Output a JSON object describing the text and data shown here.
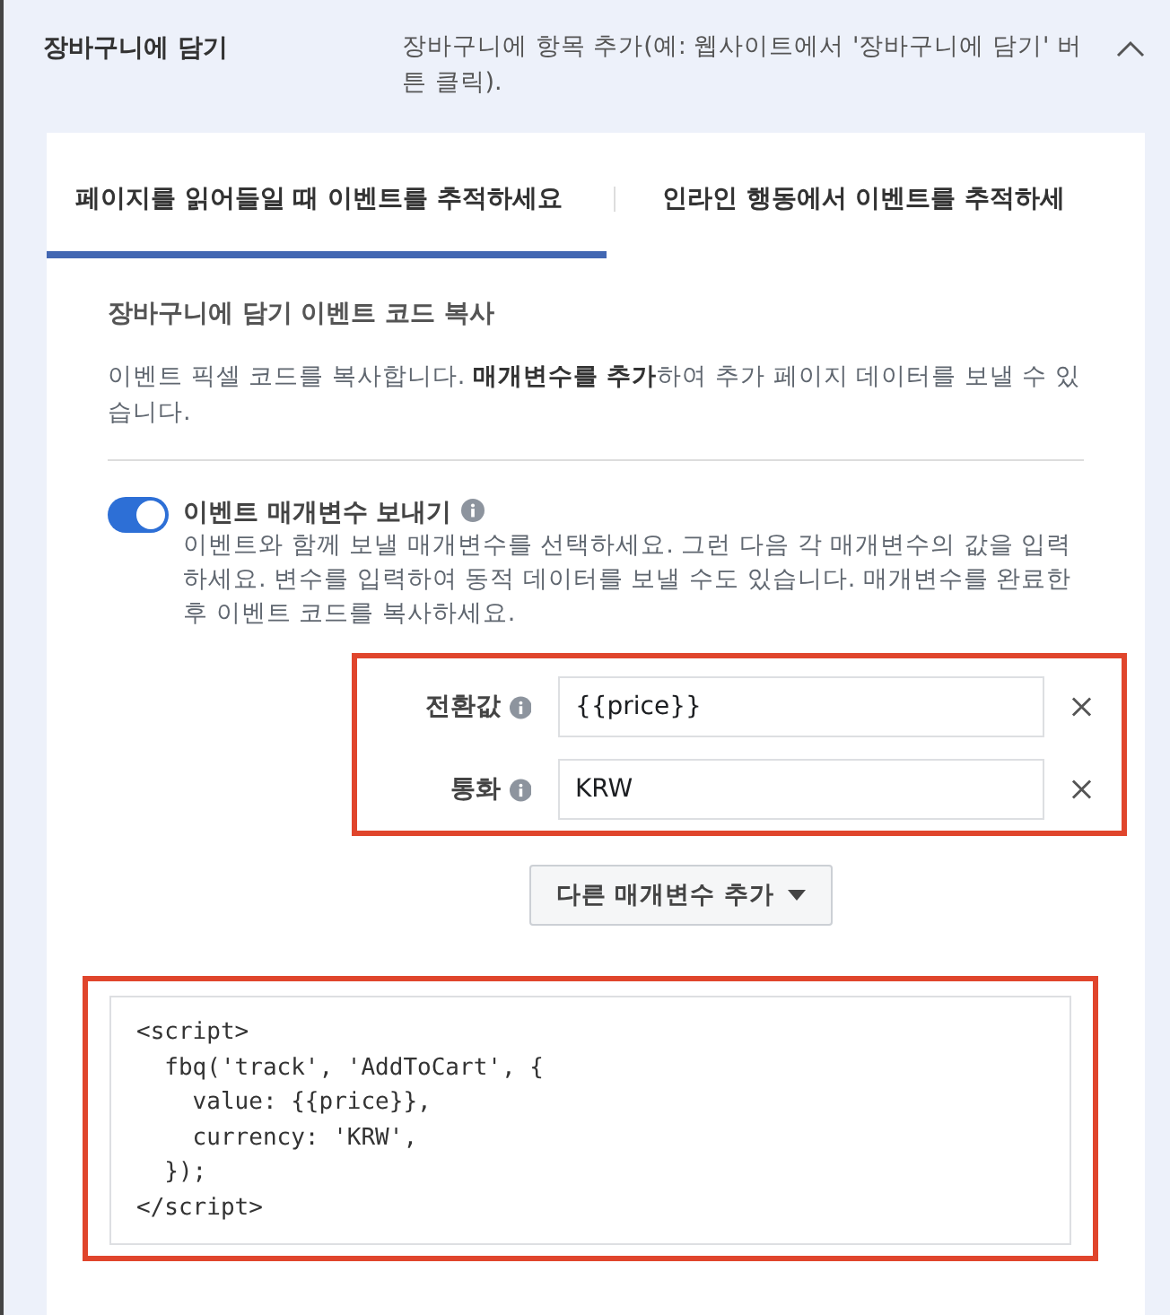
{
  "header": {
    "title": "장바구니에 담기",
    "description": "장바구니에 항목 추가(예: 웹사이트에서 '장바구니에 담기' 버튼 클릭).",
    "expanded": true
  },
  "tabs": [
    {
      "label": "페이지를 읽어들일 때 이벤트를 추적하세요",
      "selected": true
    },
    {
      "label": "인라인 행동에서 이벤트를 추적하세",
      "selected": false
    }
  ],
  "section": {
    "title": "장바구니에 담기 이벤트 코드 복사",
    "description": "이벤트 픽셀 코드를 복사합니다. **매개변수를 추가**하여 추가 페이지 데이터를 보낼 수 있습니다."
  },
  "parameters_toggle": {
    "label": "이벤트 매개변수 보내기",
    "on": true,
    "description": "이벤트와 함께 보낼 매개변수를 선택하세요. 그런 다음 각 매개변수의 값을 입력하세요. 변수를 입력하여 동적 데이터를 보낼 수도 있습니다. 매개변수를 완료한 후 이벤트 코드를 복사하세요."
  },
  "parameters": {
    "highlighted": true,
    "items": [
      {
        "label": "전환값",
        "value": "{{price}}"
      },
      {
        "label": "통화",
        "value": "KRW"
      }
    ]
  },
  "add_parameter_button": "다른 매개변수 추가",
  "code": {
    "highlighted": true,
    "lines": [
      "<script>",
      "  fbq('track', 'AddToCart', {",
      "    value: {{price}},",
      "    currency: 'KRW',",
      "  });",
      "</script>"
    ]
  }
}
